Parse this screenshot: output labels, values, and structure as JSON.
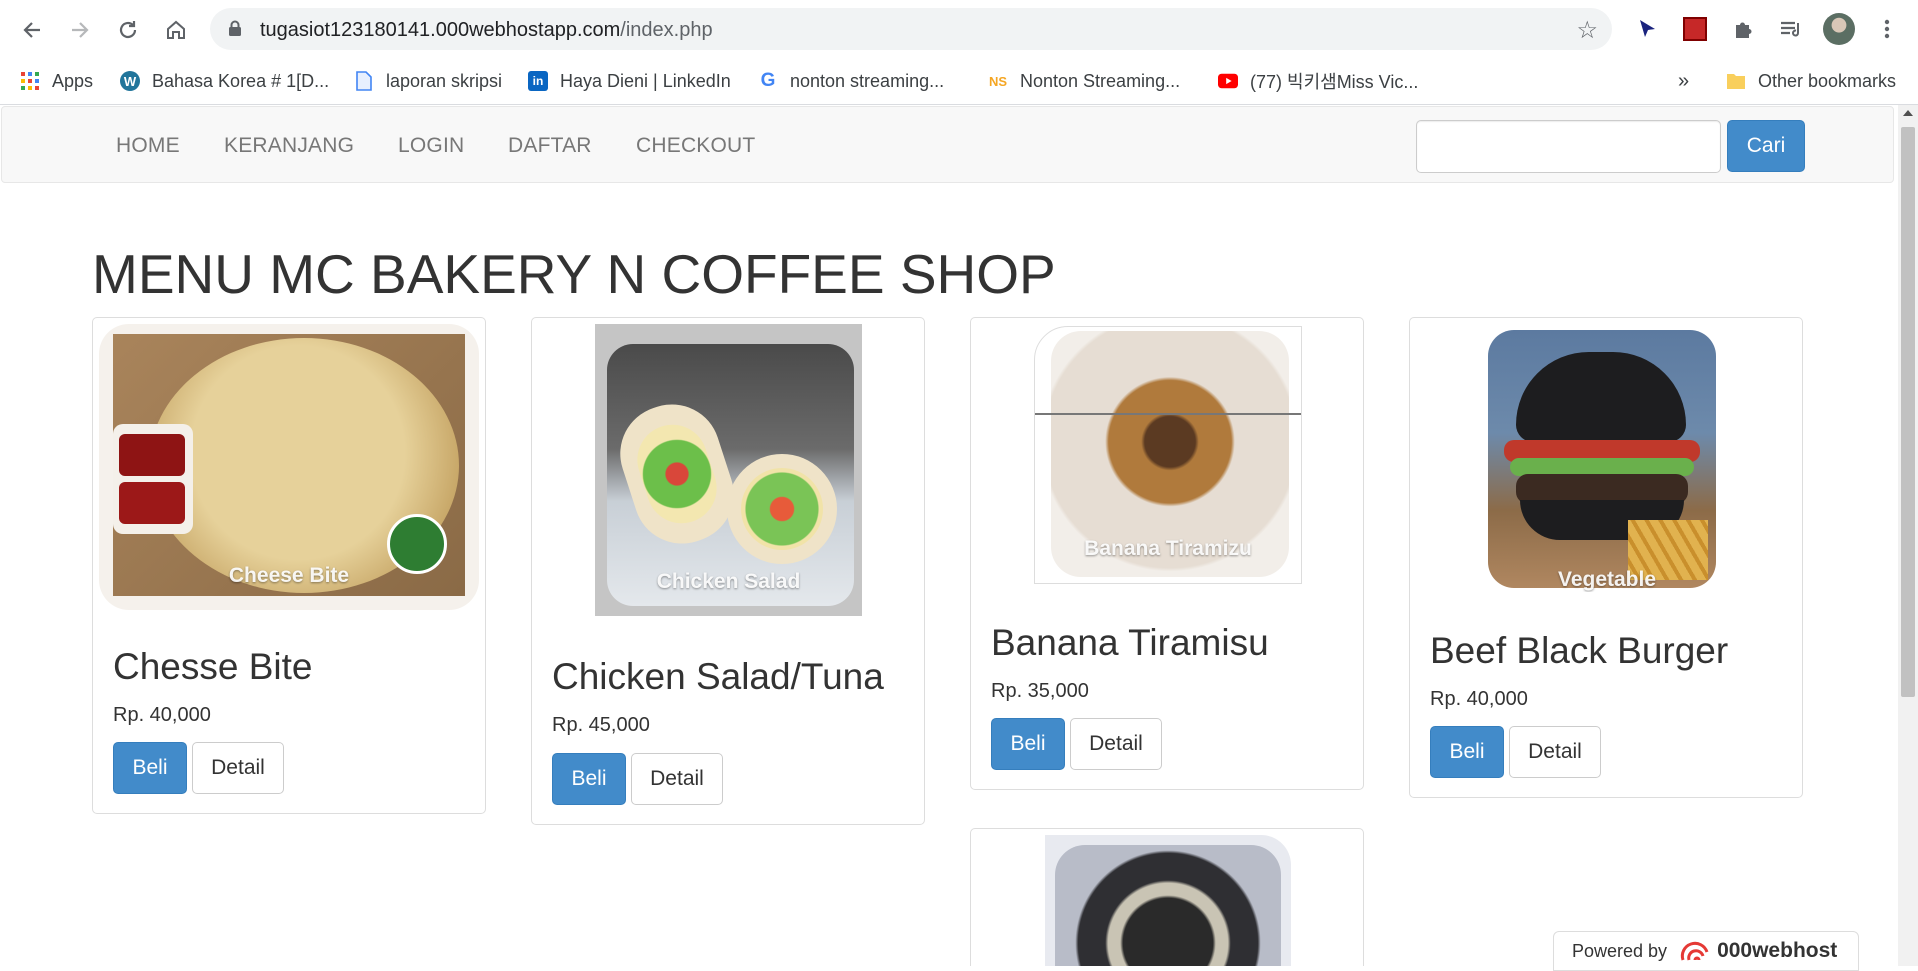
{
  "browser": {
    "url_host": "tugasiot123180141.000webhostapp.com",
    "url_path": "/index.php",
    "bookmarks": [
      {
        "label": "Apps",
        "icon": "apps-grid-icon"
      },
      {
        "label": "Bahasa Korea # 1[D...",
        "icon": "wordpress-icon"
      },
      {
        "label": "laporan skripsi",
        "icon": "document-icon"
      },
      {
        "label": "Haya Dieni | LinkedIn",
        "icon": "linkedin-icon"
      },
      {
        "label": "nonton streaming...",
        "icon": "google-icon"
      },
      {
        "label": "Nonton Streaming...",
        "icon": "ns-icon"
      },
      {
        "label": "(77) 빅키샘Miss Vic...",
        "icon": "youtube-icon"
      }
    ],
    "overflow_label": "»",
    "other_bookmarks": "Other bookmarks"
  },
  "navbar": {
    "links": [
      "HOME",
      "KERANJANG",
      "LOGIN",
      "DAFTAR",
      "CHECKOUT"
    ],
    "search_placeholder": "",
    "search_button": "Cari"
  },
  "page_title": "MENU MC BAKERY N COFFEE SHOP",
  "products": [
    {
      "name": "Chesse Bite",
      "price": "Rp. 40,000",
      "caption": "Cheese Bite",
      "buy": "Beli",
      "detail": "Detail"
    },
    {
      "name": "Chicken Salad/Tuna",
      "price": "Rp. 45,000",
      "caption": "Chicken Salad",
      "buy": "Beli",
      "detail": "Detail"
    },
    {
      "name": "Banana Tiramisu",
      "price": "Rp. 35,000",
      "caption": "Banana Tiramizu",
      "buy": "Beli",
      "detail": "Detail"
    },
    {
      "name": "Beef Black Burger",
      "price": "Rp. 40,000",
      "caption": "Vegetable",
      "buy": "Beli",
      "detail": "Detail"
    }
  ],
  "footer": {
    "powered_by": "Powered by",
    "brand": "000webhost"
  },
  "colors": {
    "primary": "#428bca",
    "navbar_bg": "#f8f8f8",
    "text": "#333333"
  }
}
